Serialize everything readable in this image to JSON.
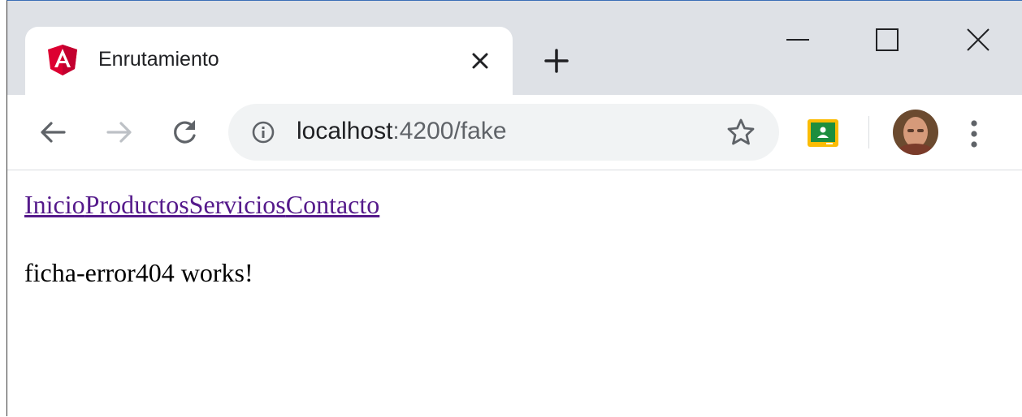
{
  "browser": {
    "tab": {
      "title": "Enrutamiento",
      "favicon": "angular-icon"
    },
    "window_controls": [
      "minimize-icon",
      "maximize-icon",
      "close-icon"
    ],
    "address_bar": {
      "host": "localhost",
      "port_path": ":4200/fake"
    },
    "colors": {
      "titlebar": "#dee1e6",
      "omnibox": "#f1f3f4",
      "angular_red": "#dd0031",
      "classroom_green": "#1e8e3e",
      "classroom_yellow": "#fbbc04"
    }
  },
  "page": {
    "nav_links": [
      {
        "label": "Inicio"
      },
      {
        "label": "Productos"
      },
      {
        "label": "Servicios"
      },
      {
        "label": "Contacto"
      }
    ],
    "message": "ficha-error404 works!",
    "link_color": "#551a8b"
  }
}
